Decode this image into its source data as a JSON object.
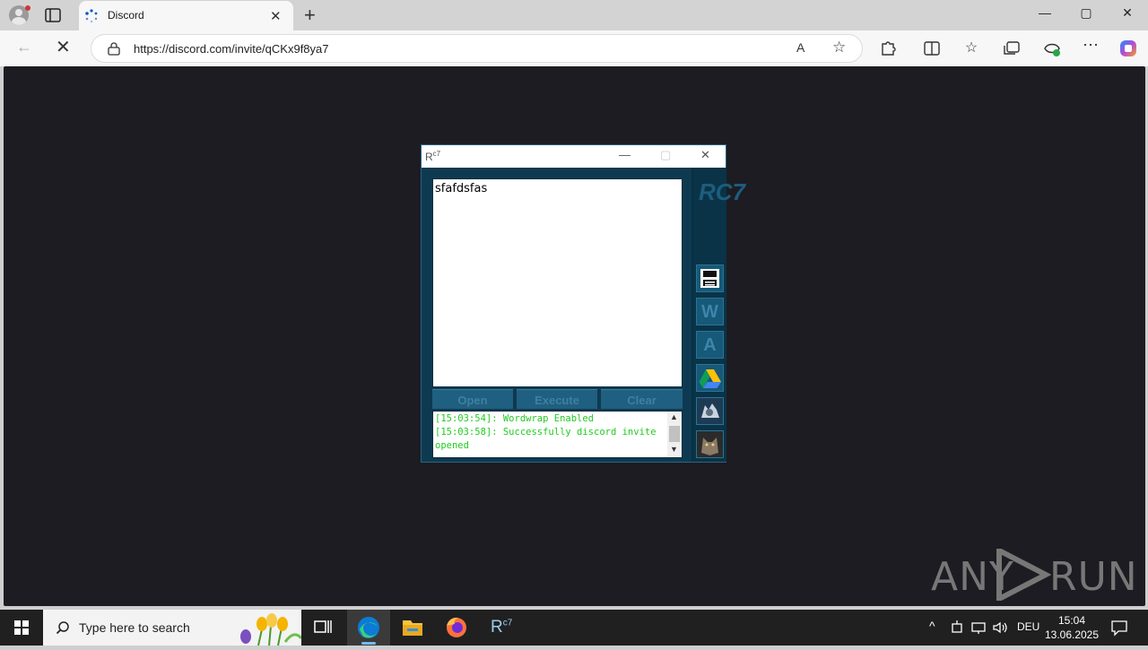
{
  "browser": {
    "tab_title": "Discord",
    "url": "https://discord.com/invite/qCKx9f8ya7",
    "read_aloud_glyph": "A",
    "window_controls": [
      "—",
      "▢",
      "✕"
    ]
  },
  "rc7": {
    "title_logo": "R",
    "title_logo_sup": "c7",
    "brand": "RC7",
    "editor_text": "sfafdsfas",
    "buttons": {
      "open": "Open",
      "execute": "Execute",
      "clear": "Clear"
    },
    "console_lines": [
      "[15:03:54]: Wordwrap Enabled",
      "[15:03:58]: Successfully discord invite opened"
    ],
    "side_buttons": [
      {
        "icon": "save-icon"
      },
      {
        "icon": "wordwrap-icon",
        "label": "W"
      },
      {
        "icon": "autoexec-icon",
        "label": "A"
      },
      {
        "icon": "google-drive-icon"
      },
      {
        "icon": "wolf-icon-1"
      },
      {
        "icon": "wolf-icon-2"
      }
    ]
  },
  "watermark": {
    "left": "ANY",
    "right": "RUN"
  },
  "taskbar": {
    "search_placeholder": "Type here to search",
    "language": "DEU",
    "time": "15:04",
    "date": "13.06.2025",
    "taskbar_r7_label": "R",
    "taskbar_r7_sup": "c7"
  }
}
